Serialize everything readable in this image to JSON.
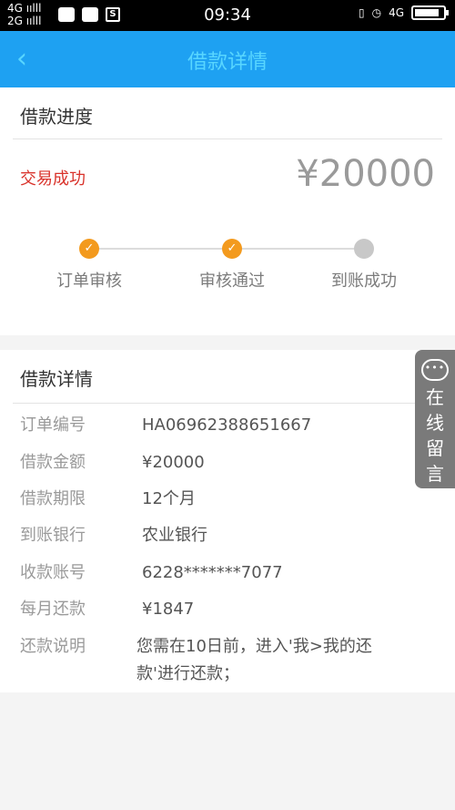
{
  "status_bar": {
    "net_top": "4G ıılll",
    "net_bottom": "2G ıılll",
    "time": "09:34",
    "right_net": "4G",
    "icons": [
      "wechat-icon",
      "message-icon",
      "s-box-icon"
    ]
  },
  "nav": {
    "back_glyph": "‹",
    "title": "借款详情"
  },
  "progress_section": {
    "title": "借款进度",
    "status": "交易成功",
    "amount": "¥20000",
    "steps": [
      {
        "label": "订单审核",
        "done": true
      },
      {
        "label": "审核通过",
        "done": true
      },
      {
        "label": "到账成功",
        "done": false
      }
    ]
  },
  "details_section": {
    "title": "借款详情",
    "rows": [
      {
        "label": "订单编号",
        "value": "HA06962388651667"
      },
      {
        "label": "借款金额",
        "value": "¥20000"
      },
      {
        "label": "借款期限",
        "value": "12个月"
      },
      {
        "label": "到账银行",
        "value": "农业银行"
      },
      {
        "label": "收款账号",
        "value": "6228*******7077"
      },
      {
        "label": "每月还款",
        "value": "¥1847"
      },
      {
        "label": "还款说明",
        "value": "您需在10日前，进入'我>我的还款'进行还款；"
      }
    ]
  },
  "side_button": {
    "label": "在线留言"
  },
  "colors": {
    "nav_bg": "#1ea1f2",
    "nav_text": "#58d6ff",
    "status_red": "#d9332b",
    "step_done": "#f39a1e",
    "step_pending": "#c8c8c8"
  }
}
